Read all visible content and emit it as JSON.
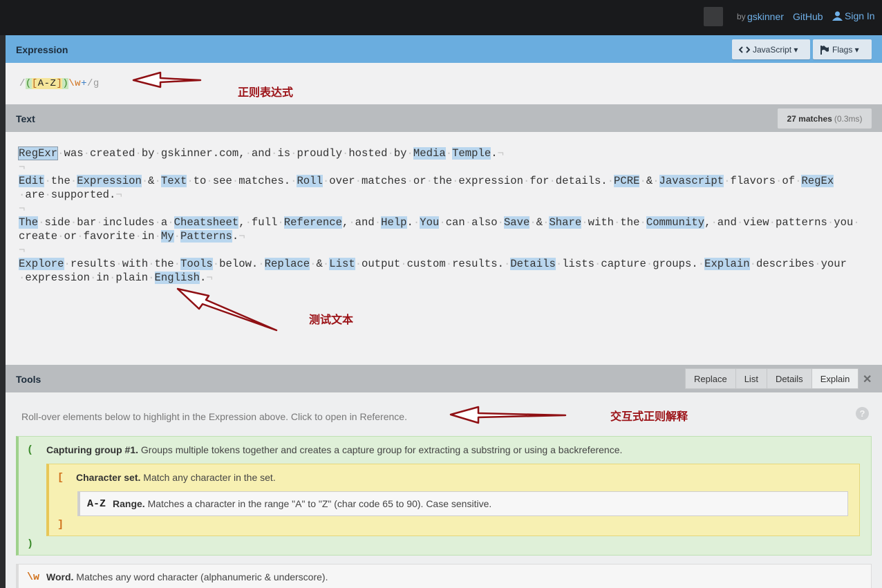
{
  "topbar": {
    "by_label": "by",
    "author": "gskinner",
    "github": "GitHub",
    "signin": "Sign In"
  },
  "expression": {
    "title": "Expression",
    "language_button": "JavaScript ▾",
    "flags_button": "Flags ▾",
    "regex_parts": {
      "open_slash": "/",
      "group_open": "(",
      "set_open": "[",
      "range": "A-Z",
      "set_close": "]",
      "group_close": ")",
      "escape": "\\w",
      "quantifier": "+",
      "close_slash": "/",
      "flag": "g"
    },
    "annotation": "正则表达式"
  },
  "text_panel": {
    "title": "Text",
    "matches_count": "27 matches",
    "matches_time": "(0.3ms)",
    "annotation": "测试文本"
  },
  "tools": {
    "title": "Tools",
    "tabs": [
      "Replace",
      "List",
      "Details",
      "Explain"
    ],
    "active_tab": "Explain",
    "close": "✕",
    "hint": "Roll-over elements below to highlight in the Expression above. Click to open in Reference.",
    "help": "?",
    "annotation": "交互式正则解释",
    "explain": {
      "group": {
        "open_token": "(",
        "close_token": ")",
        "name": "Capturing group #1.",
        "text": "Groups multiple tokens together and creates a capture group for extracting a substring or using a backreference."
      },
      "set": {
        "open_token": "[",
        "close_token": "]",
        "name": "Character set.",
        "text": "Match any character in the set."
      },
      "range": {
        "token": "A-Z",
        "name": "Range.",
        "text": "Matches a character in the range \"A\" to \"Z\" (char code 65 to 90). Case sensitive."
      },
      "word": {
        "token": "\\w",
        "name": "Word.",
        "text": "Matches any word character (alphanumeric & underscore)."
      }
    }
  },
  "colors": {
    "expression_header": "#6aaddf",
    "match_highlight": "#b9d6ee",
    "annotation": "#9b1116",
    "group_box": "#dff0d8",
    "set_box": "#f7f0b2"
  }
}
